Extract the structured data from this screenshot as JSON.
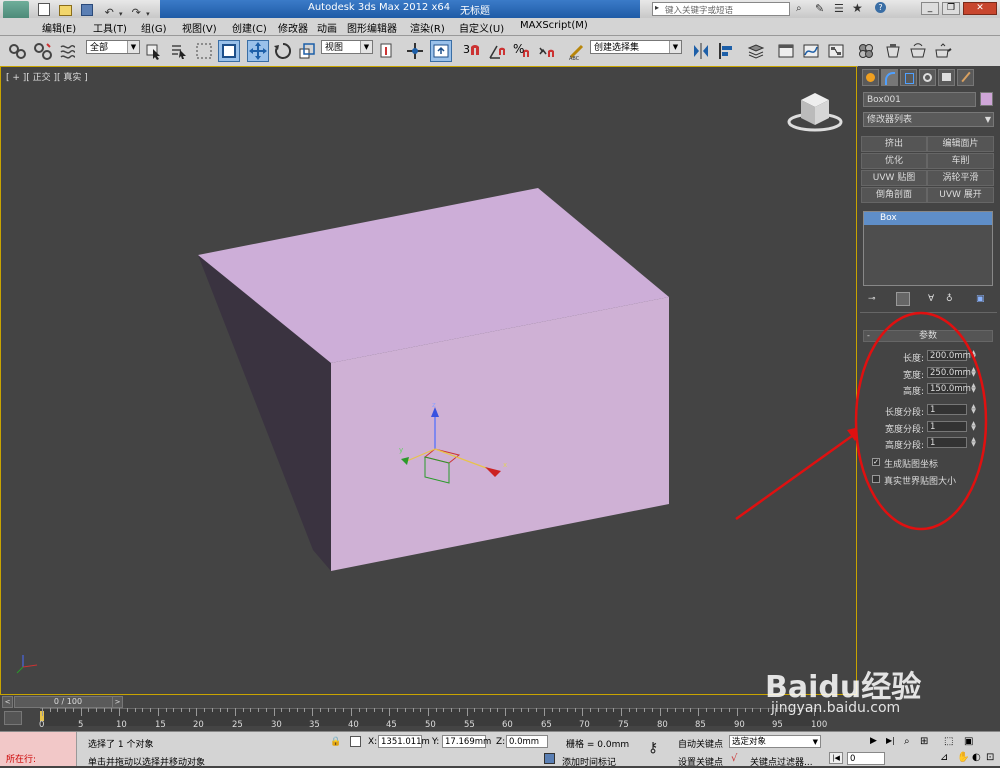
{
  "app": {
    "title": "Autodesk 3ds Max  2012 x64",
    "doc_title": "无标题",
    "search_placeholder": "键入关键字或短语"
  },
  "menu": [
    "编辑(E)",
    "工具(T)",
    "组(G)",
    "视图(V)",
    "创建(C)",
    "修改器",
    "动画",
    "图形编辑器",
    "渲染(R)",
    "自定义(U)",
    "MAXScript(M)"
  ],
  "toolbar": {
    "selection_filter": "全部",
    "ref_coord": "视图",
    "snap_number": "3",
    "named_selection": "创建选择集"
  },
  "viewport": {
    "label": "[ + ][ 正交 ][ 真实 ]",
    "object_color": "#cfb1d5",
    "gizmo_labels": {
      "x": "x",
      "y": "y",
      "z": "z"
    }
  },
  "command_panel": {
    "object_name": "Box001",
    "object_swatch": "#cfa6d8",
    "modifier_list": "修改器列表",
    "modifier_buttons": [
      [
        "挤出",
        "编辑面片"
      ],
      [
        "优化",
        "车削"
      ],
      [
        "UVW 贴图",
        "涡轮平滑"
      ],
      [
        "倒角剖面",
        "UVW 展开"
      ]
    ],
    "stack_item": "Box",
    "rollout_title": "参数",
    "params": [
      {
        "label": "长度:",
        "value": "200.0mm"
      },
      {
        "label": "宽度:",
        "value": "250.0mm"
      },
      {
        "label": "高度:",
        "value": "150.0mm"
      }
    ],
    "segments": [
      {
        "label": "长度分段:",
        "value": "1"
      },
      {
        "label": "宽度分段:",
        "value": "1"
      },
      {
        "label": "高度分段:",
        "value": "1"
      }
    ],
    "checkboxes": [
      {
        "label": "生成贴图坐标",
        "checked": true
      },
      {
        "label": "真实世界贴图大小",
        "checked": false
      }
    ]
  },
  "timeline": {
    "slider": "0 / 100",
    "ticks": [
      "0",
      "5",
      "10",
      "15",
      "20",
      "25",
      "30",
      "35",
      "40",
      "45",
      "50",
      "55",
      "60",
      "65",
      "70",
      "75",
      "80",
      "85",
      "90",
      "95",
      "100"
    ]
  },
  "status": {
    "running": "所在行:",
    "message1": "选择了 1 个对象",
    "message2": "单击并拖动以选择并移动对象",
    "x_label": "X:",
    "x_value": "1351.011m",
    "y_label": "Y:",
    "y_value": "17.169mm",
    "z_label": "Z:",
    "z_value": "0.0mm",
    "grid": "栅格 = 0.0mm",
    "auto_key": "自动关键点",
    "set_key": "设置关键点",
    "selected_objects": "选定对象",
    "add_time_tag": "添加时间标记",
    "key_filters": "关键点过滤器...",
    "frame_value": "0"
  },
  "watermark": {
    "brand": "Baidu经验",
    "url": "jingyan.baidu.com"
  }
}
